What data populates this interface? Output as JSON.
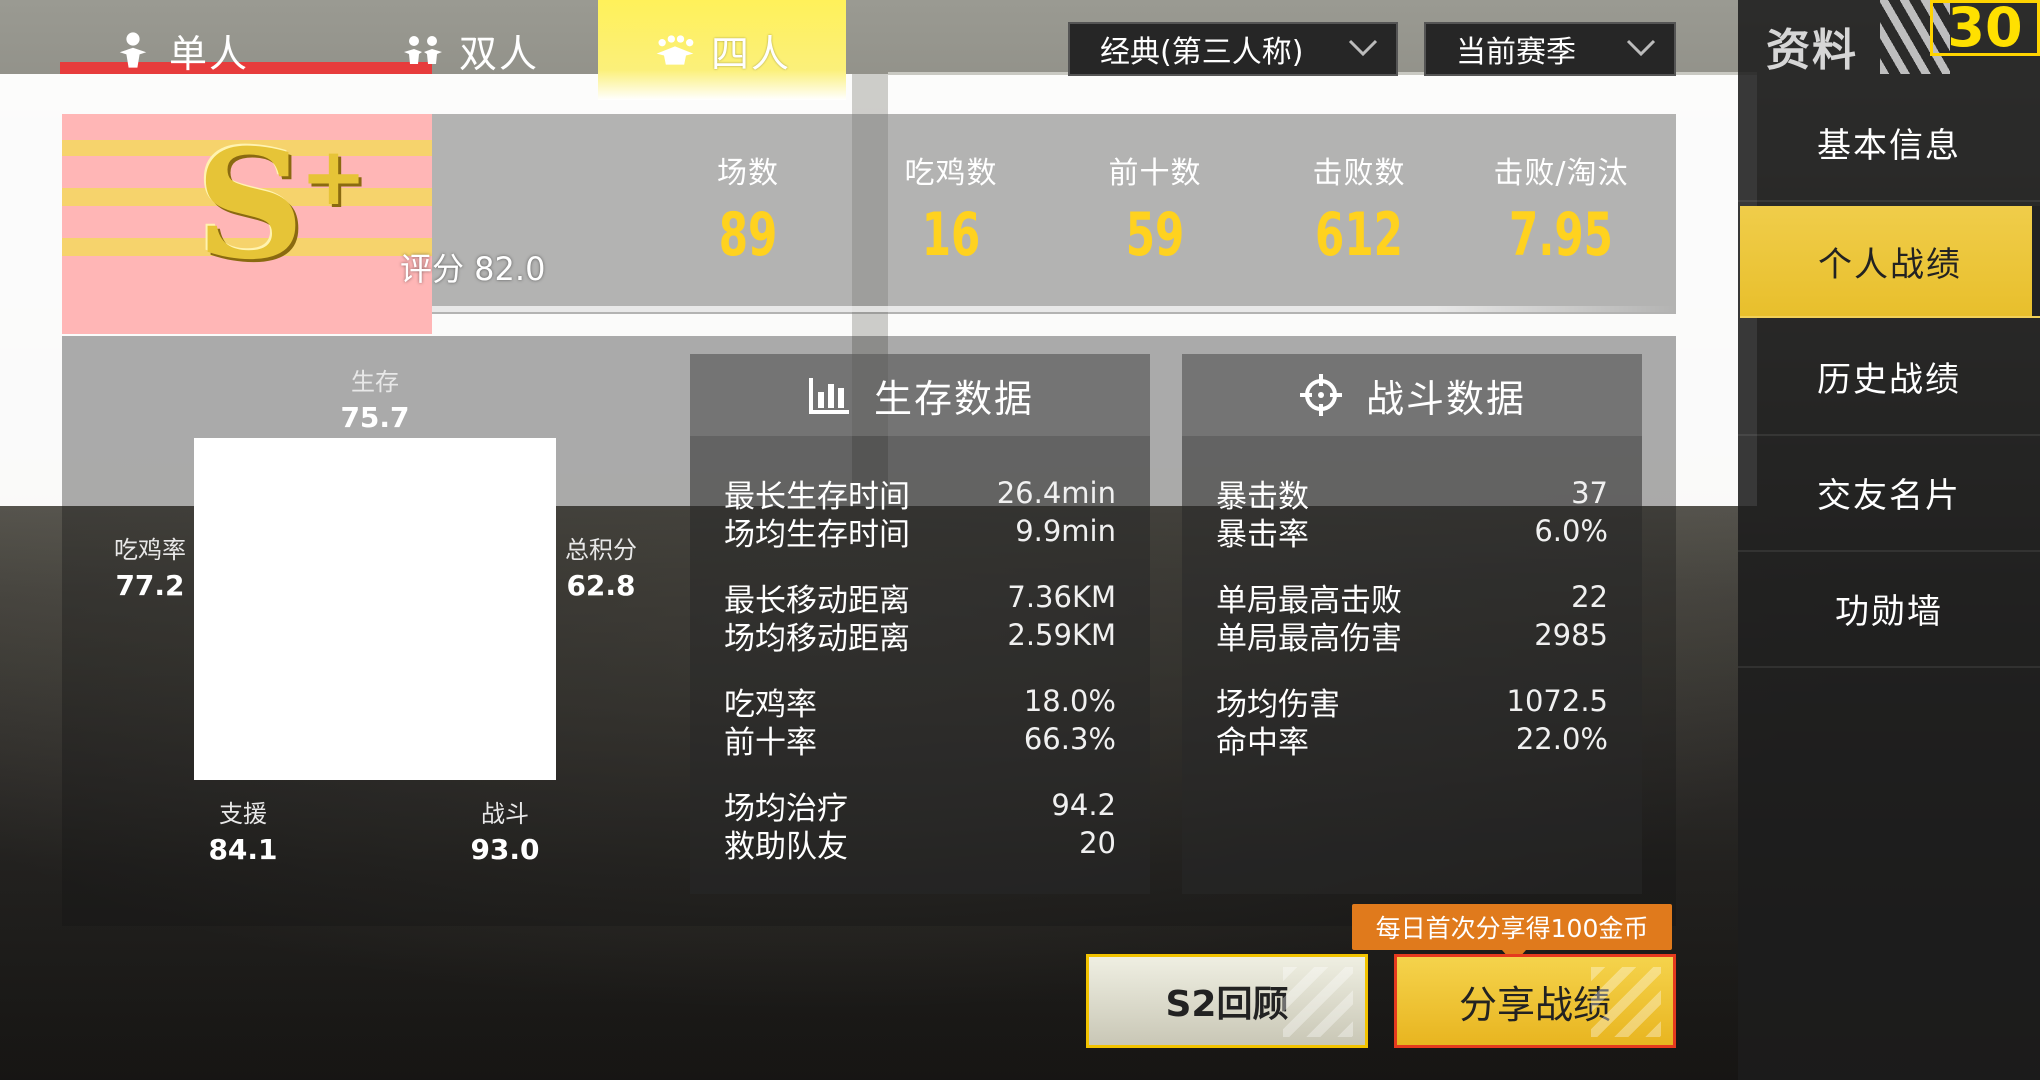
{
  "mode_tabs": {
    "solo": "单人",
    "duo": "双人",
    "squad": "四人",
    "active": "squad"
  },
  "dropdowns": {
    "mode": "经典(第三人称)",
    "season": "当前赛季"
  },
  "sidebar": {
    "title": "资料",
    "badge": "30",
    "items": [
      {
        "label": "基本信息"
      },
      {
        "label": "个人战绩",
        "active": true
      },
      {
        "label": "历史战绩"
      },
      {
        "label": "交友名片"
      },
      {
        "label": "功勋墙"
      }
    ]
  },
  "rank": {
    "grade": "S",
    "plus": "+",
    "rating_label": "评分 82.0"
  },
  "summary_stats": [
    {
      "label": "场数",
      "value": "89"
    },
    {
      "label": "吃鸡数",
      "value": "16"
    },
    {
      "label": "前十数",
      "value": "59"
    },
    {
      "label": "击败数",
      "value": "612"
    },
    {
      "label": "击败/淘汰",
      "value": "7.95"
    }
  ],
  "radar": {
    "survive": {
      "label": "生存",
      "value": "75.7"
    },
    "winrate": {
      "label": "吃鸡率",
      "value": "77.2"
    },
    "total": {
      "label": "总积分",
      "value": "62.8"
    },
    "support": {
      "label": "支援",
      "value": "84.1"
    },
    "combat": {
      "label": "战斗",
      "value": "93.0"
    }
  },
  "survival_card": {
    "title": "生存数据",
    "rows": [
      {
        "k": "最长生存时间",
        "v": "26.4min"
      },
      {
        "k": "场均生存时间",
        "v": "9.9min"
      },
      {
        "k": "最长移动距离",
        "v": "7.36KM"
      },
      {
        "k": "场均移动距离",
        "v": "2.59KM"
      },
      {
        "k": "吃鸡率",
        "v": "18.0%"
      },
      {
        "k": "前十率",
        "v": "66.3%"
      },
      {
        "k": "场均治疗",
        "v": "94.2"
      },
      {
        "k": "救助队友",
        "v": "20"
      }
    ]
  },
  "combat_card": {
    "title": "战斗数据",
    "rows": [
      {
        "k": "暴击数",
        "v": "37"
      },
      {
        "k": "暴击率",
        "v": "6.0%"
      },
      {
        "k": "单局最高击败",
        "v": "22"
      },
      {
        "k": "单局最高伤害",
        "v": "2985"
      },
      {
        "k": "场均伤害",
        "v": "1072.5"
      },
      {
        "k": "命中率",
        "v": "22.0%"
      }
    ]
  },
  "share_tip": "每日首次分享得100金币",
  "buttons": {
    "review": "S2回顾",
    "share": "分享战绩"
  },
  "colors": {
    "accent_yellow": "#ffd21f",
    "tab_active": "#fff15a",
    "share_orange": "#e07a1c"
  }
}
